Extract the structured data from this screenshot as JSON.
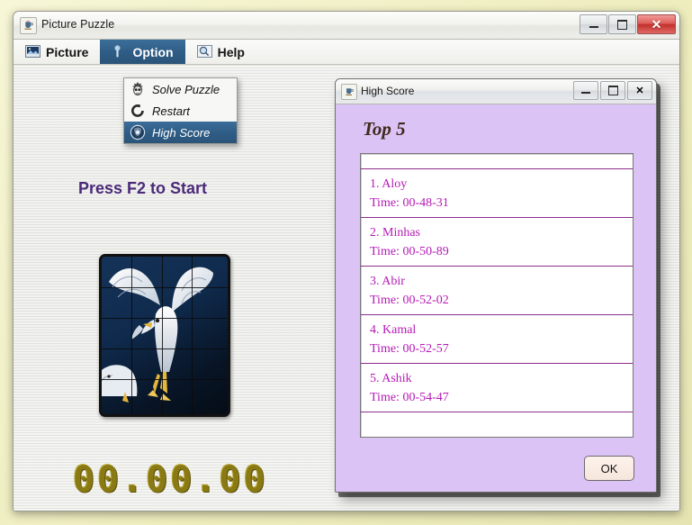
{
  "desktop": {
    "background": "#f2f1c8"
  },
  "main_window": {
    "title": "Picture Puzzle",
    "icon": "java-coffee-cup-icon",
    "controls": {
      "minimize": "minimize-icon",
      "maximize": "maximize-icon",
      "close": "✕"
    },
    "menubar": [
      {
        "label": "Picture",
        "icon": "picture-icon",
        "selected": false
      },
      {
        "label": "Option",
        "icon": "option-pin-icon",
        "selected": true
      },
      {
        "label": "Help",
        "icon": "magnifier-icon",
        "selected": false
      }
    ],
    "dropdown": {
      "owner": "Option",
      "items": [
        {
          "label": "Solve Puzzle",
          "icon": "robot-icon",
          "active": false
        },
        {
          "label": "Restart",
          "icon": "restart-arrow-icon",
          "active": false
        },
        {
          "label": "High Score",
          "icon": "shield-star-icon",
          "active": true
        }
      ]
    },
    "content": {
      "prompt": "Press F2 to Start",
      "puzzle_image": "seagull-photo",
      "puzzle_grid": {
        "cols": 4,
        "rows": 5
      },
      "timer": "00.00.00",
      "timer_color": "#8a7a14"
    }
  },
  "high_score_dialog": {
    "title": "High Score",
    "icon": "java-coffee-cup-icon",
    "controls": {
      "minimize": "minimize-icon",
      "maximize": "maximize-icon",
      "close": "✕"
    },
    "heading": "Top 5",
    "background_color": "#dcc3f5",
    "text_color": "#b51ab5",
    "entries": [
      {
        "name": "1. Aloy",
        "time": "Time: 00-48-31"
      },
      {
        "name": "2. Minhas",
        "time": "Time: 00-50-89"
      },
      {
        "name": "3. Abir",
        "time": "Time: 00-52-02"
      },
      {
        "name": "4. Kamal",
        "time": "Time: 00-52-57"
      },
      {
        "name": "5. Ashik",
        "time": "Time: 00-54-47"
      }
    ],
    "ok_label": "OK"
  }
}
